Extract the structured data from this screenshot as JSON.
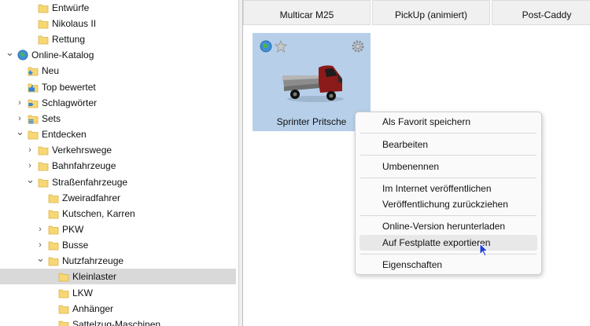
{
  "tree": [
    {
      "label": "Entwürfe",
      "icon": "folder-icon",
      "chevron": "none",
      "selected": false
    },
    {
      "label": "Nikolaus II",
      "icon": "folder-icon",
      "chevron": "none",
      "selected": false
    },
    {
      "label": "Rettung",
      "icon": "folder-icon",
      "chevron": "none",
      "selected": false
    },
    {
      "label": "Online-Katalog",
      "icon": "globe-icon",
      "chevron": "expanded",
      "selected": false
    },
    {
      "label": "Neu",
      "icon": "new-folder-icon",
      "chevron": "none",
      "selected": false
    },
    {
      "label": "Top bewertet",
      "icon": "thumbs-up-folder-icon",
      "chevron": "none",
      "selected": false
    },
    {
      "label": "Schlagwörter",
      "icon": "tag-folder-icon",
      "chevron": "collapsed",
      "selected": false
    },
    {
      "label": "Sets",
      "icon": "set-folder-icon",
      "chevron": "collapsed",
      "selected": false
    },
    {
      "label": "Entdecken",
      "icon": "folder-icon",
      "chevron": "expanded",
      "selected": false
    },
    {
      "label": "Verkehrswege",
      "icon": "folder-icon",
      "chevron": "collapsed",
      "selected": false
    },
    {
      "label": "Bahnfahrzeuge",
      "icon": "folder-icon",
      "chevron": "collapsed",
      "selected": false
    },
    {
      "label": "Straßenfahrzeuge",
      "icon": "folder-icon",
      "chevron": "expanded",
      "selected": false
    },
    {
      "label": "Zweiradfahrer",
      "icon": "folder-icon",
      "chevron": "none",
      "selected": false
    },
    {
      "label": "Kutschen, Karren",
      "icon": "folder-icon",
      "chevron": "none",
      "selected": false
    },
    {
      "label": "PKW",
      "icon": "folder-icon",
      "chevron": "collapsed",
      "selected": false
    },
    {
      "label": "Busse",
      "icon": "folder-icon",
      "chevron": "collapsed",
      "selected": false
    },
    {
      "label": "Nutzfahrzeuge",
      "icon": "folder-icon",
      "chevron": "expanded",
      "selected": false
    },
    {
      "label": "Kleinlaster",
      "icon": "folder-icon",
      "chevron": "none",
      "selected": true
    },
    {
      "label": "LKW",
      "icon": "folder-icon",
      "chevron": "none",
      "selected": false
    },
    {
      "label": "Anhänger",
      "icon": "folder-icon",
      "chevron": "none",
      "selected": false
    },
    {
      "label": "Sattelzug-Maschinen",
      "icon": "folder-icon",
      "chevron": "none",
      "selected": false
    }
  ],
  "top_cards": [
    "Multicar M25",
    "PickUp (animiert)",
    "Post-Caddy"
  ],
  "tile": {
    "name": "Sprinter Pritsche",
    "icons": [
      "globe-icon",
      "star-icon",
      "gear-icon"
    ],
    "selection_color": "#b7cfe9"
  },
  "menu": {
    "items": [
      {
        "label": "Als Favorit speichern",
        "highlighted": false
      },
      {
        "label": "Bearbeiten",
        "highlighted": false
      },
      {
        "label": "Umbenennen",
        "highlighted": false
      },
      {
        "label": "Im Internet veröffentlichen",
        "highlighted": false
      },
      {
        "label": "Veröffentlichung zurückziehen",
        "highlighted": false
      },
      {
        "label": "Online-Version herunterladen",
        "highlighted": false
      },
      {
        "label": "Auf Festplatte exportieren",
        "highlighted": true
      },
      {
        "label": "Eigenschaften",
        "highlighted": false
      }
    ]
  },
  "colors": {
    "folder": "#f7d774",
    "accent": "#1e5aa8",
    "truck": "#8b1a1a",
    "highlight": "#e8e8e8"
  }
}
